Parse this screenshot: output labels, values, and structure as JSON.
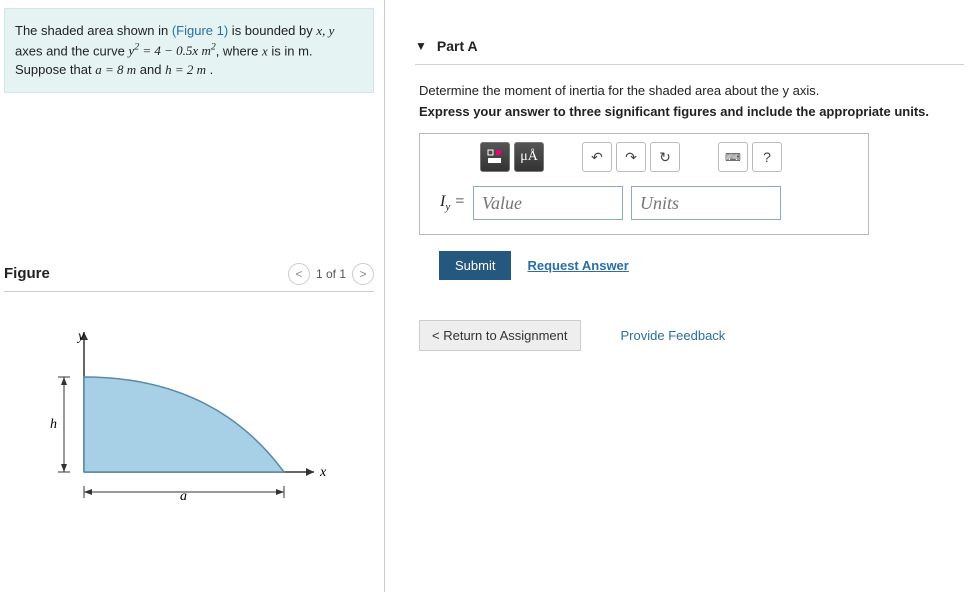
{
  "problem": {
    "text_pre": "The shaded area shown in ",
    "figure_link": "(Figure 1)",
    "text_mid": " is bounded by ",
    "axes": "x, y",
    "text2": " axes and the curve ",
    "equation": "y² = 4 − 0.5x m²",
    "text3": ", where ",
    "xvar": "x",
    "text4": " is in ",
    "unit_m": "m",
    "text5": ". Suppose that ",
    "a_eq": "a = 8  m",
    "and": " and ",
    "h_eq": "h = 2  m",
    "period": " ."
  },
  "figure": {
    "title": "Figure",
    "pager": "1 of 1",
    "labels": {
      "y": "y",
      "x": "x",
      "h": "h",
      "a": "a"
    }
  },
  "partA": {
    "label": "Part A",
    "instruction1": "Determine the moment of inertia for the shaded area about the y axis.",
    "instruction2": "Express your answer to three significant figures and include the appropriate units.",
    "symbol": "I",
    "subscript": "y",
    "equals": " = ",
    "value_placeholder": "Value",
    "units_placeholder": "Units",
    "toolbar": {
      "templates": "templates",
      "units_btn": "μÅ",
      "undo": "↶",
      "redo": "↷",
      "reset": "↻",
      "keyboard": "⌨",
      "help": "?"
    },
    "submit": "Submit",
    "request": "Request Answer"
  },
  "footer": {
    "return": "Return to Assignment",
    "feedback": "Provide Feedback"
  }
}
